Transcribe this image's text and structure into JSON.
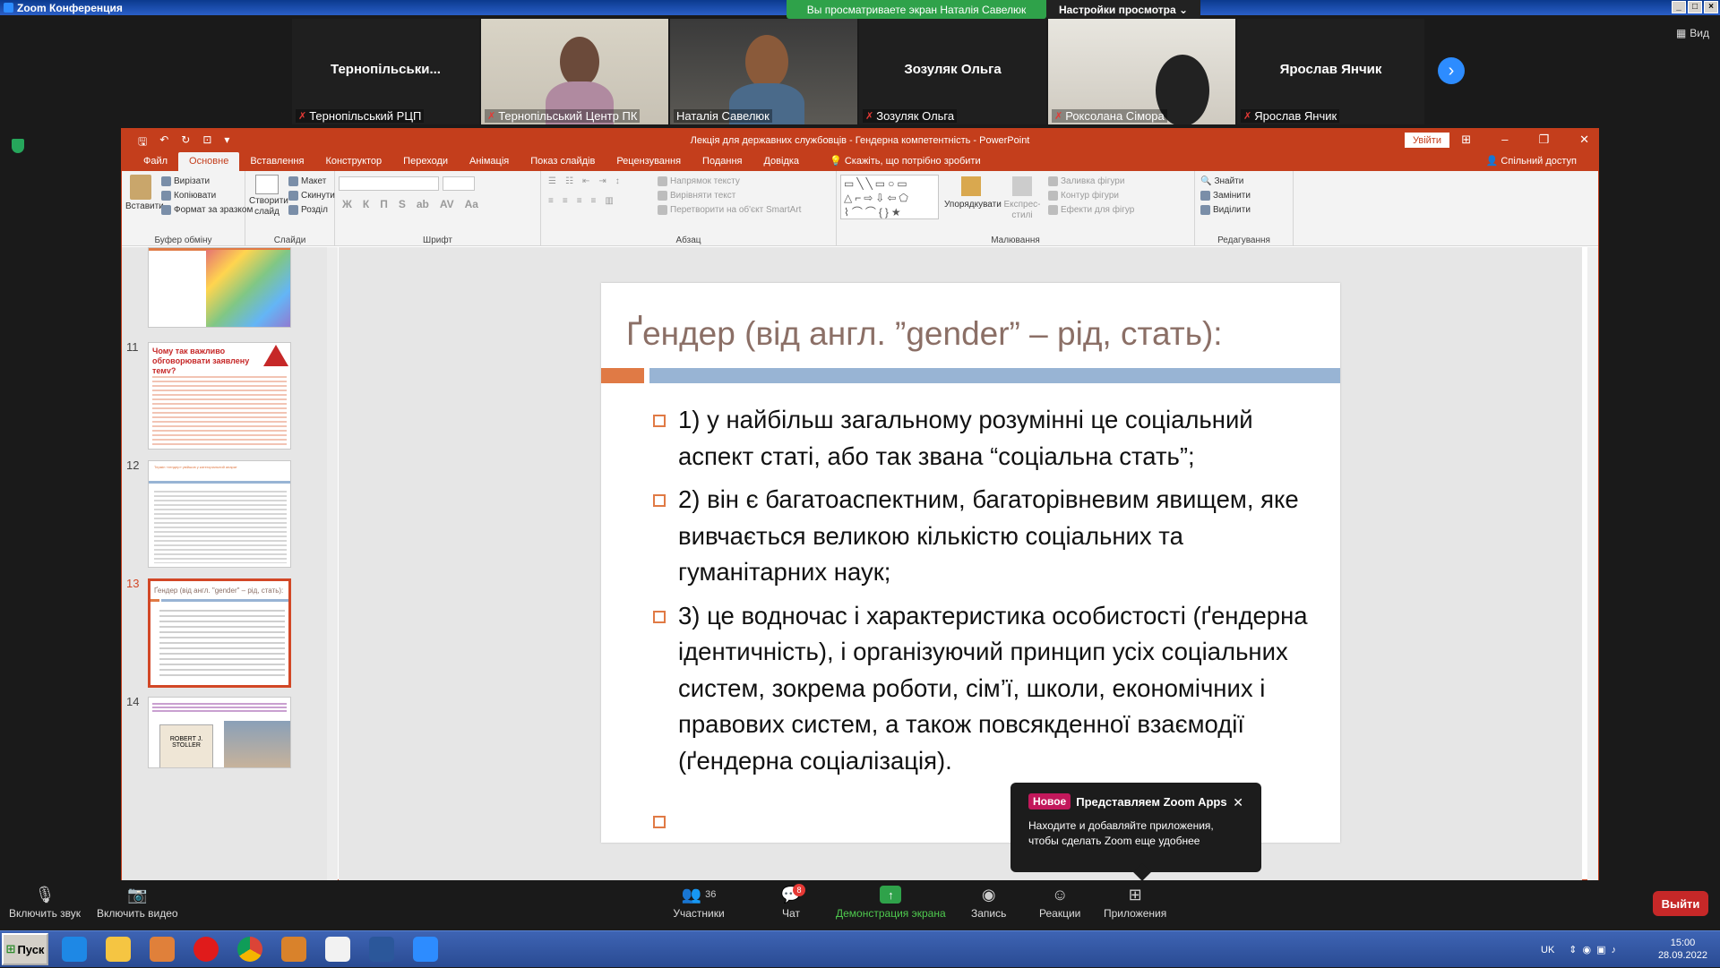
{
  "zoom": {
    "window_title": "Zoom Конференция",
    "share_banner": "Вы просматриваете экран Наталія Савелюк",
    "view_settings": "Настройки просмотра ⌄",
    "view_label": "Вид",
    "participants_tiles": [
      {
        "name": "Тернопільськи...",
        "label": "Тернопільський РЦП",
        "video": false
      },
      {
        "name": "",
        "label": "Тернопільський Центр ПК",
        "video": true
      },
      {
        "name": "",
        "label": "Наталія Савелюк",
        "video": true
      },
      {
        "name": "Зозуляк Ольга",
        "label": "Зозуляк Ольга",
        "video": false
      },
      {
        "name": "",
        "label": "Роксолана Сімора",
        "video": true
      },
      {
        "name": "Ярослав Янчик",
        "label": "Ярослав Янчик",
        "video": false
      }
    ],
    "toolbar": {
      "audio": "Включить звук",
      "video": "Включить видео",
      "participants": "Участники",
      "participants_count": "36",
      "chat": "Чат",
      "chat_badge": "8",
      "share": "Демонстрация экрана",
      "record": "Запись",
      "reactions": "Реакции",
      "apps": "Приложения",
      "leave": "Выйти"
    },
    "popup": {
      "badge": "Новое",
      "title": "Представляем Zoom Apps",
      "text": "Находите и добавляйте приложения, чтобы сделать Zoom еще удобнее"
    }
  },
  "powerpoint": {
    "title": "Лекція для державних службовців - Гендерна компетентність - PowerPoint",
    "signin": "Увійти",
    "tabs": [
      "Файл",
      "Основне",
      "Вставлення",
      "Конструктор",
      "Переходи",
      "Анімація",
      "Показ слайдів",
      "Рецензування",
      "Подання",
      "Довідка"
    ],
    "tell_me": "Скажіть, що потрібно зробити",
    "share": "Спільний доступ",
    "ribbon": {
      "paste": "Вставити",
      "cut": "Вирізати",
      "copy": "Копіювати",
      "format_painter": "Формат за зразком",
      "clipboard_group": "Буфер обміну",
      "new_slide": "Створити слайд",
      "layout": "Макет",
      "reset": "Скинути",
      "section": "Розділ",
      "slides_group": "Слайди",
      "font_group": "Шрифт",
      "text_direction": "Напрямок тексту",
      "align_text": "Вирівняти текст",
      "smartart": "Перетворити на об'єкт SmartArt",
      "paragraph_group": "Абзац",
      "arrange": "Упорядкувати",
      "quick_styles": "Експрес-стилі",
      "shape_fill": "Заливка фігури",
      "shape_outline": "Контур фігури",
      "shape_effects": "Ефекти для фігур",
      "drawing_group": "Малювання",
      "find": "Знайти",
      "replace": "Замінити",
      "select": "Виділити",
      "editing_group": "Редагування"
    },
    "thumbnails": [
      {
        "num": "11",
        "title": "Чому так важливо обговорювати заявлену тему?"
      },
      {
        "num": "12",
        "title": "Термін «гендер» увійшов у категоріальний апарат"
      },
      {
        "num": "13",
        "title": "Ґендер (від англ. \"gender\" – рід, стать):"
      },
      {
        "num": "14",
        "title": "ROBERT J. STOLLER"
      }
    ],
    "slide": {
      "title": "Ґендер (від англ. ”gender” – рід, стать):",
      "bullets": [
        "1) у найбільш загальному розумінні це соціальний аспект статі, або так звана “соціальна стать”;",
        "2) він є багатоаспектним, багаторівневим явищем, яке вивчається великою кількістю соціальних та гуманітарних наук;",
        "3) це водночас і характеристика особистості (ґендерна ідентичність), і організуючий принцип усіх соціальних систем, зокрема роботи, сім’ї, школи, економічних і правових систем, а також повсякденної взаємодії (ґендерна соціалізація)."
      ]
    }
  },
  "taskbar": {
    "start": "Пуск",
    "lang": "UK",
    "time": "15:00",
    "date": "28.09.2022"
  },
  "colors": {
    "pp_red": "#c43e1c",
    "zoom_green": "#2fa24a",
    "slide_orange": "#e07a45",
    "slide_blue": "#98b4d4"
  }
}
